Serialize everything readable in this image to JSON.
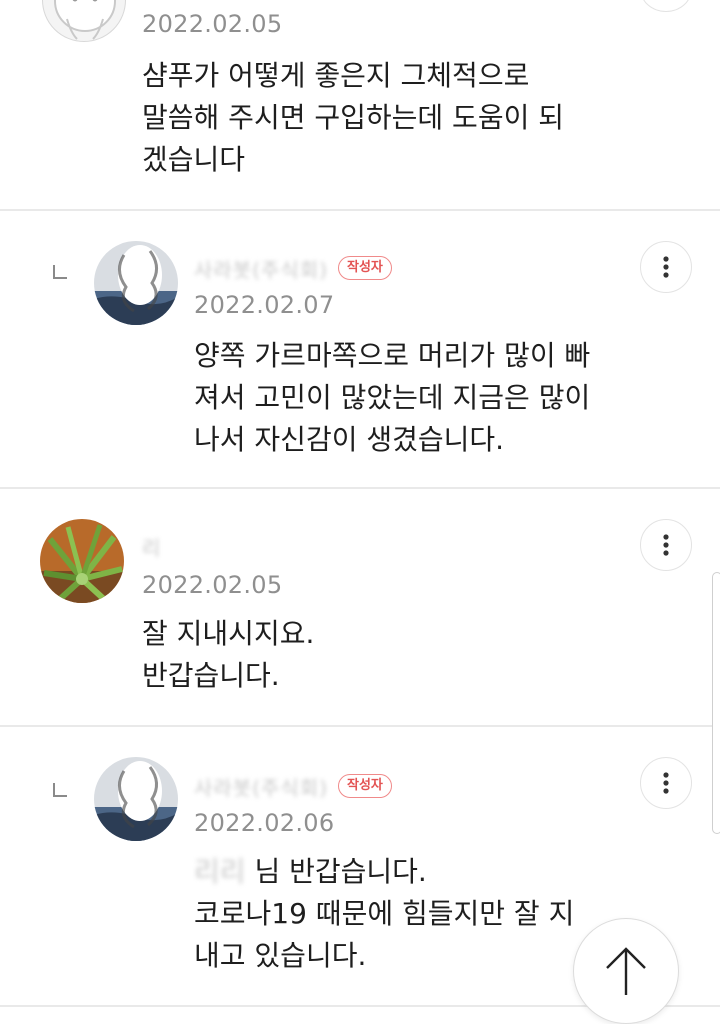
{
  "comments": [
    {
      "is_reply": false,
      "author_name": "",
      "is_author": false,
      "date": "2022.02.05",
      "lines": [
        "샴푸가 어떻게 좋은지 그체적으로",
        "말씀해 주시면 구입하는데 도움이 되",
        "겠습니다"
      ]
    },
    {
      "is_reply": true,
      "author_name": "사라봇(주식회)",
      "is_author": true,
      "badge": "작성자",
      "date": "2022.02.07",
      "lines": [
        "양쪽 가르마쪽으로 머리가 많이 빠",
        "져서 고민이 많았는데 지금은 많이",
        "나서 자신감이 생겼습니다."
      ]
    },
    {
      "is_reply": false,
      "author_name": "리",
      "is_author": false,
      "date": "2022.02.05",
      "lines": [
        "잘 지내시지요.",
        "반갑습니다."
      ]
    },
    {
      "is_reply": true,
      "author_name": "사라봇(주식회)",
      "is_author": true,
      "badge": "작성자",
      "date": "2022.02.06",
      "mention": "리리",
      "lines": [
        "님 반갑습니다.",
        "코로나19 때문에 힘들지만 잘 지",
        "내고 있습니다."
      ]
    }
  ],
  "icons": {
    "more": "more-vertical-icon",
    "reply": "reply-corner-icon",
    "scroll_top": "arrow-up-icon"
  },
  "colors": {
    "badge": "#e35353",
    "date": "#8f8f8f",
    "divider": "#e9e9e9"
  }
}
